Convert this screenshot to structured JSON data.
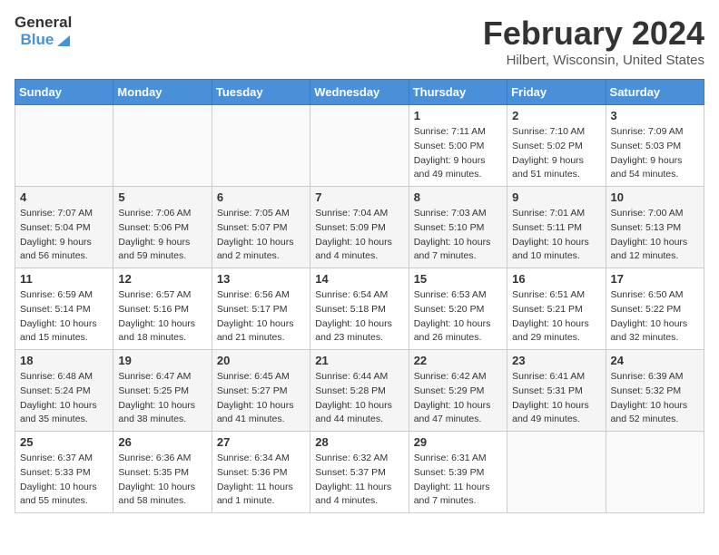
{
  "header": {
    "logo_general": "General",
    "logo_blue": "Blue",
    "title": "February 2024",
    "subtitle": "Hilbert, Wisconsin, United States"
  },
  "days_of_week": [
    "Sunday",
    "Monday",
    "Tuesday",
    "Wednesday",
    "Thursday",
    "Friday",
    "Saturday"
  ],
  "weeks": [
    [
      {
        "day": "",
        "sunrise": "",
        "sunset": "",
        "daylight": "",
        "empty": true
      },
      {
        "day": "",
        "sunrise": "",
        "sunset": "",
        "daylight": "",
        "empty": true
      },
      {
        "day": "",
        "sunrise": "",
        "sunset": "",
        "daylight": "",
        "empty": true
      },
      {
        "day": "",
        "sunrise": "",
        "sunset": "",
        "daylight": "",
        "empty": true
      },
      {
        "day": "1",
        "sunrise": "7:11 AM",
        "sunset": "5:00 PM",
        "daylight": "9 hours and 49 minutes.",
        "empty": false
      },
      {
        "day": "2",
        "sunrise": "7:10 AM",
        "sunset": "5:02 PM",
        "daylight": "9 hours and 51 minutes.",
        "empty": false
      },
      {
        "day": "3",
        "sunrise": "7:09 AM",
        "sunset": "5:03 PM",
        "daylight": "9 hours and 54 minutes.",
        "empty": false
      }
    ],
    [
      {
        "day": "4",
        "sunrise": "7:07 AM",
        "sunset": "5:04 PM",
        "daylight": "9 hours and 56 minutes.",
        "empty": false
      },
      {
        "day": "5",
        "sunrise": "7:06 AM",
        "sunset": "5:06 PM",
        "daylight": "9 hours and 59 minutes.",
        "empty": false
      },
      {
        "day": "6",
        "sunrise": "7:05 AM",
        "sunset": "5:07 PM",
        "daylight": "10 hours and 2 minutes.",
        "empty": false
      },
      {
        "day": "7",
        "sunrise": "7:04 AM",
        "sunset": "5:09 PM",
        "daylight": "10 hours and 4 minutes.",
        "empty": false
      },
      {
        "day": "8",
        "sunrise": "7:03 AM",
        "sunset": "5:10 PM",
        "daylight": "10 hours and 7 minutes.",
        "empty": false
      },
      {
        "day": "9",
        "sunrise": "7:01 AM",
        "sunset": "5:11 PM",
        "daylight": "10 hours and 10 minutes.",
        "empty": false
      },
      {
        "day": "10",
        "sunrise": "7:00 AM",
        "sunset": "5:13 PM",
        "daylight": "10 hours and 12 minutes.",
        "empty": false
      }
    ],
    [
      {
        "day": "11",
        "sunrise": "6:59 AM",
        "sunset": "5:14 PM",
        "daylight": "10 hours and 15 minutes.",
        "empty": false
      },
      {
        "day": "12",
        "sunrise": "6:57 AM",
        "sunset": "5:16 PM",
        "daylight": "10 hours and 18 minutes.",
        "empty": false
      },
      {
        "day": "13",
        "sunrise": "6:56 AM",
        "sunset": "5:17 PM",
        "daylight": "10 hours and 21 minutes.",
        "empty": false
      },
      {
        "day": "14",
        "sunrise": "6:54 AM",
        "sunset": "5:18 PM",
        "daylight": "10 hours and 23 minutes.",
        "empty": false
      },
      {
        "day": "15",
        "sunrise": "6:53 AM",
        "sunset": "5:20 PM",
        "daylight": "10 hours and 26 minutes.",
        "empty": false
      },
      {
        "day": "16",
        "sunrise": "6:51 AM",
        "sunset": "5:21 PM",
        "daylight": "10 hours and 29 minutes.",
        "empty": false
      },
      {
        "day": "17",
        "sunrise": "6:50 AM",
        "sunset": "5:22 PM",
        "daylight": "10 hours and 32 minutes.",
        "empty": false
      }
    ],
    [
      {
        "day": "18",
        "sunrise": "6:48 AM",
        "sunset": "5:24 PM",
        "daylight": "10 hours and 35 minutes.",
        "empty": false
      },
      {
        "day": "19",
        "sunrise": "6:47 AM",
        "sunset": "5:25 PM",
        "daylight": "10 hours and 38 minutes.",
        "empty": false
      },
      {
        "day": "20",
        "sunrise": "6:45 AM",
        "sunset": "5:27 PM",
        "daylight": "10 hours and 41 minutes.",
        "empty": false
      },
      {
        "day": "21",
        "sunrise": "6:44 AM",
        "sunset": "5:28 PM",
        "daylight": "10 hours and 44 minutes.",
        "empty": false
      },
      {
        "day": "22",
        "sunrise": "6:42 AM",
        "sunset": "5:29 PM",
        "daylight": "10 hours and 47 minutes.",
        "empty": false
      },
      {
        "day": "23",
        "sunrise": "6:41 AM",
        "sunset": "5:31 PM",
        "daylight": "10 hours and 49 minutes.",
        "empty": false
      },
      {
        "day": "24",
        "sunrise": "6:39 AM",
        "sunset": "5:32 PM",
        "daylight": "10 hours and 52 minutes.",
        "empty": false
      }
    ],
    [
      {
        "day": "25",
        "sunrise": "6:37 AM",
        "sunset": "5:33 PM",
        "daylight": "10 hours and 55 minutes.",
        "empty": false
      },
      {
        "day": "26",
        "sunrise": "6:36 AM",
        "sunset": "5:35 PM",
        "daylight": "10 hours and 58 minutes.",
        "empty": false
      },
      {
        "day": "27",
        "sunrise": "6:34 AM",
        "sunset": "5:36 PM",
        "daylight": "11 hours and 1 minute.",
        "empty": false
      },
      {
        "day": "28",
        "sunrise": "6:32 AM",
        "sunset": "5:37 PM",
        "daylight": "11 hours and 4 minutes.",
        "empty": false
      },
      {
        "day": "29",
        "sunrise": "6:31 AM",
        "sunset": "5:39 PM",
        "daylight": "11 hours and 7 minutes.",
        "empty": false
      },
      {
        "day": "",
        "sunrise": "",
        "sunset": "",
        "daylight": "",
        "empty": true
      },
      {
        "day": "",
        "sunrise": "",
        "sunset": "",
        "daylight": "",
        "empty": true
      }
    ]
  ],
  "labels": {
    "sunrise_prefix": "Sunrise: ",
    "sunset_prefix": "Sunset: ",
    "daylight_prefix": "Daylight: "
  }
}
